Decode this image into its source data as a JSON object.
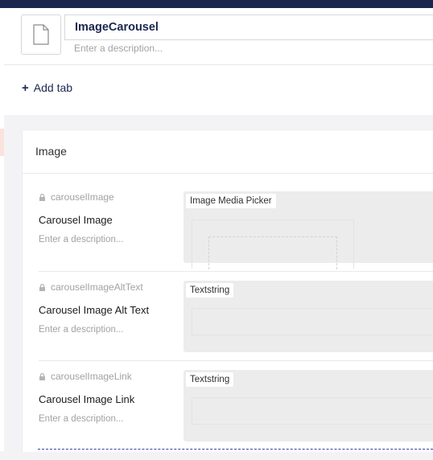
{
  "header": {
    "name_value": "ImageCarousel",
    "description_placeholder": "Enter a description..."
  },
  "tabs": {
    "add_tab_label": "Add tab"
  },
  "group": {
    "title": "Image",
    "properties": [
      {
        "alias": "carouselImage",
        "name": "Carousel Image",
        "description": "Enter a description...",
        "editor": "Image Media Picker"
      },
      {
        "alias": "carouselImageAltText",
        "name": "Carousel Image Alt Text",
        "description": "Enter a description...",
        "editor": "Textstring"
      },
      {
        "alias": "carouselImageLink",
        "name": "Carousel Image Link",
        "description": "Enter a description...",
        "editor": "Textstring"
      }
    ]
  },
  "icons": {
    "doc_type_icon": "document-icon",
    "lock_icon": "lock-icon",
    "add_icon": "plus-icon"
  },
  "colors": {
    "brand_dark": "#1b264f",
    "drop_indicator": "#3544b1",
    "editor_bg": "#ececec"
  }
}
